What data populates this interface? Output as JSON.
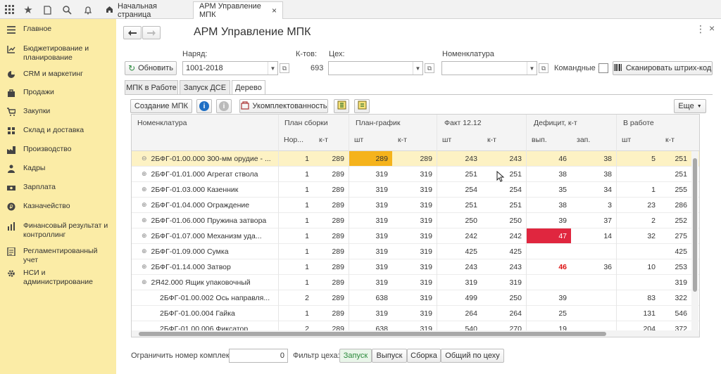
{
  "topbar": {
    "tabs": {
      "home": "Начальная страница",
      "arm": "АРМ Управление МПК"
    },
    "close": "×"
  },
  "sidebar": {
    "items": [
      {
        "id": "main",
        "icon": "menu-lines-icon",
        "label": "Главное"
      },
      {
        "id": "budget",
        "icon": "budget-chart-icon",
        "label": "Бюджетирование и планирование"
      },
      {
        "id": "crm",
        "icon": "pie-chart-icon",
        "label": "CRM и маркетинг"
      },
      {
        "id": "sales",
        "icon": "shopping-bag-icon",
        "label": "Продажи"
      },
      {
        "id": "purchases",
        "icon": "cart-icon",
        "label": "Закупки"
      },
      {
        "id": "warehouse",
        "icon": "warehouse-icon",
        "label": "Склад и доставка"
      },
      {
        "id": "production",
        "icon": "factory-icon",
        "label": "Производство"
      },
      {
        "id": "hr",
        "icon": "person-icon",
        "label": "Кадры"
      },
      {
        "id": "salary",
        "icon": "salary-icon",
        "label": "Зарплата"
      },
      {
        "id": "treasury",
        "icon": "coin-icon",
        "label": "Казначейство"
      },
      {
        "id": "finance",
        "icon": "finance-icon",
        "label": "Финансовый результат и контроллинг"
      },
      {
        "id": "regulated",
        "icon": "report-icon",
        "label": "Регламентированный учет"
      },
      {
        "id": "nsi",
        "icon": "gear-icon",
        "label": "НСИ и администрирование"
      }
    ]
  },
  "header": {
    "title": "АРМ Управление МПК",
    "more": "⋮",
    "close": "×"
  },
  "filters": {
    "refresh_label": "Обновить",
    "naryad_label": "Наряд:",
    "naryad_value": "1001-2018",
    "ktov_label": "К-тов:",
    "ktov_value": "693",
    "ceh_label": "Цех:",
    "ceh_value": "",
    "nomen_label": "Номенклатура",
    "nomen_value": "",
    "command_label": "Командные :",
    "scan_label": "Сканировать штрих-код"
  },
  "tabs": [
    "МПК в Работе",
    "Запуск ДСЕ",
    "Дерево"
  ],
  "toolbar": {
    "create": "Создание МПК",
    "complete": "Укомплектованность",
    "more": "Еще"
  },
  "grid": {
    "headers": {
      "name": "Номенклатура",
      "plan_sborki": "План сборки",
      "plan_grafik": "План-график",
      "fakt": "Факт 12.12",
      "deficit": "Дефицит, к-т",
      "v_rabote": "В работе"
    },
    "subheaders": [
      "Нор...",
      "к-т",
      "шт",
      "к-т",
      "шт",
      "к-т",
      "вып.",
      "зап.",
      "шт",
      "к-т"
    ],
    "rows": [
      {
        "mark": "⊖",
        "name": "2БФГ-01.00.000 300-мм орудие - ...",
        "v": [
          "1",
          "289",
          "289",
          "289",
          "243",
          "243",
          "46",
          "38",
          "5",
          "251"
        ]
      },
      {
        "mark": "⊕",
        "name": "2БФГ-01.01.000 Агрегат ствола",
        "v": [
          "1",
          "289",
          "319",
          "319",
          "251",
          "251",
          "38",
          "38",
          "",
          "251"
        ]
      },
      {
        "mark": "⊕",
        "name": "2БФГ-01.03.000 Казенник",
        "v": [
          "1",
          "289",
          "319",
          "319",
          "254",
          "254",
          "35",
          "34",
          "1",
          "255"
        ]
      },
      {
        "mark": "⊕",
        "name": "2БФГ-01.04.000 Ограждение",
        "v": [
          "1",
          "289",
          "319",
          "319",
          "251",
          "251",
          "38",
          "3",
          "23",
          "286"
        ]
      },
      {
        "mark": "⊕",
        "name": "2БФГ-01.06.000 Пружина затвора",
        "v": [
          "1",
          "289",
          "319",
          "319",
          "250",
          "250",
          "39",
          "37",
          "2",
          "252"
        ]
      },
      {
        "mark": "⊕",
        "name": "2БФГ-01.07.000 Механизм уда...",
        "v": [
          "1",
          "289",
          "319",
          "319",
          "242",
          "242",
          "47",
          "14",
          "32",
          "275"
        ]
      },
      {
        "mark": "⊕",
        "name": "2БФГ-01.09.000 Сумка",
        "v": [
          "1",
          "289",
          "319",
          "319",
          "425",
          "425",
          "",
          "",
          "",
          "425"
        ]
      },
      {
        "mark": "⊕",
        "name": "2БФГ-01.14.000 Затвор",
        "v": [
          "1",
          "289",
          "319",
          "319",
          "243",
          "243",
          "46",
          "36",
          "10",
          "253"
        ]
      },
      {
        "mark": "⊕",
        "name": "2Я42.000 Ящик упаковочный",
        "v": [
          "1",
          "289",
          "319",
          "319",
          "319",
          "319",
          "",
          "",
          "",
          "319"
        ]
      },
      {
        "mark": "",
        "name": "2БФГ-01.00.002 Ось направля...",
        "v": [
          "2",
          "289",
          "638",
          "319",
          "499",
          "250",
          "39",
          "",
          "83",
          "322"
        ]
      },
      {
        "mark": "",
        "name": "2БФГ-01.00.004 Гайка",
        "v": [
          "1",
          "289",
          "319",
          "319",
          "264",
          "264",
          "25",
          "",
          "131",
          "546"
        ]
      },
      {
        "mark": "",
        "name": "2БФГ-01.00.006 Фиксатор",
        "v": [
          "2",
          "289",
          "638",
          "319",
          "540",
          "270",
          "19",
          "",
          "204",
          "372"
        ]
      }
    ]
  },
  "footer": {
    "limit_label": "Ограничить номер комплекта:",
    "limit_value": "0",
    "filter_label": "Фильтр цеха:",
    "filter_buttons": [
      "Запуск",
      "Выпуск",
      "Сборка",
      "Общий по цеху"
    ]
  },
  "colors": {
    "sidebar": "#fbeca6",
    "highlight_row": "#fdf2c4",
    "orange_cell": "#f5b31c",
    "red_cell": "#e0263f",
    "red_text": "#d11"
  }
}
